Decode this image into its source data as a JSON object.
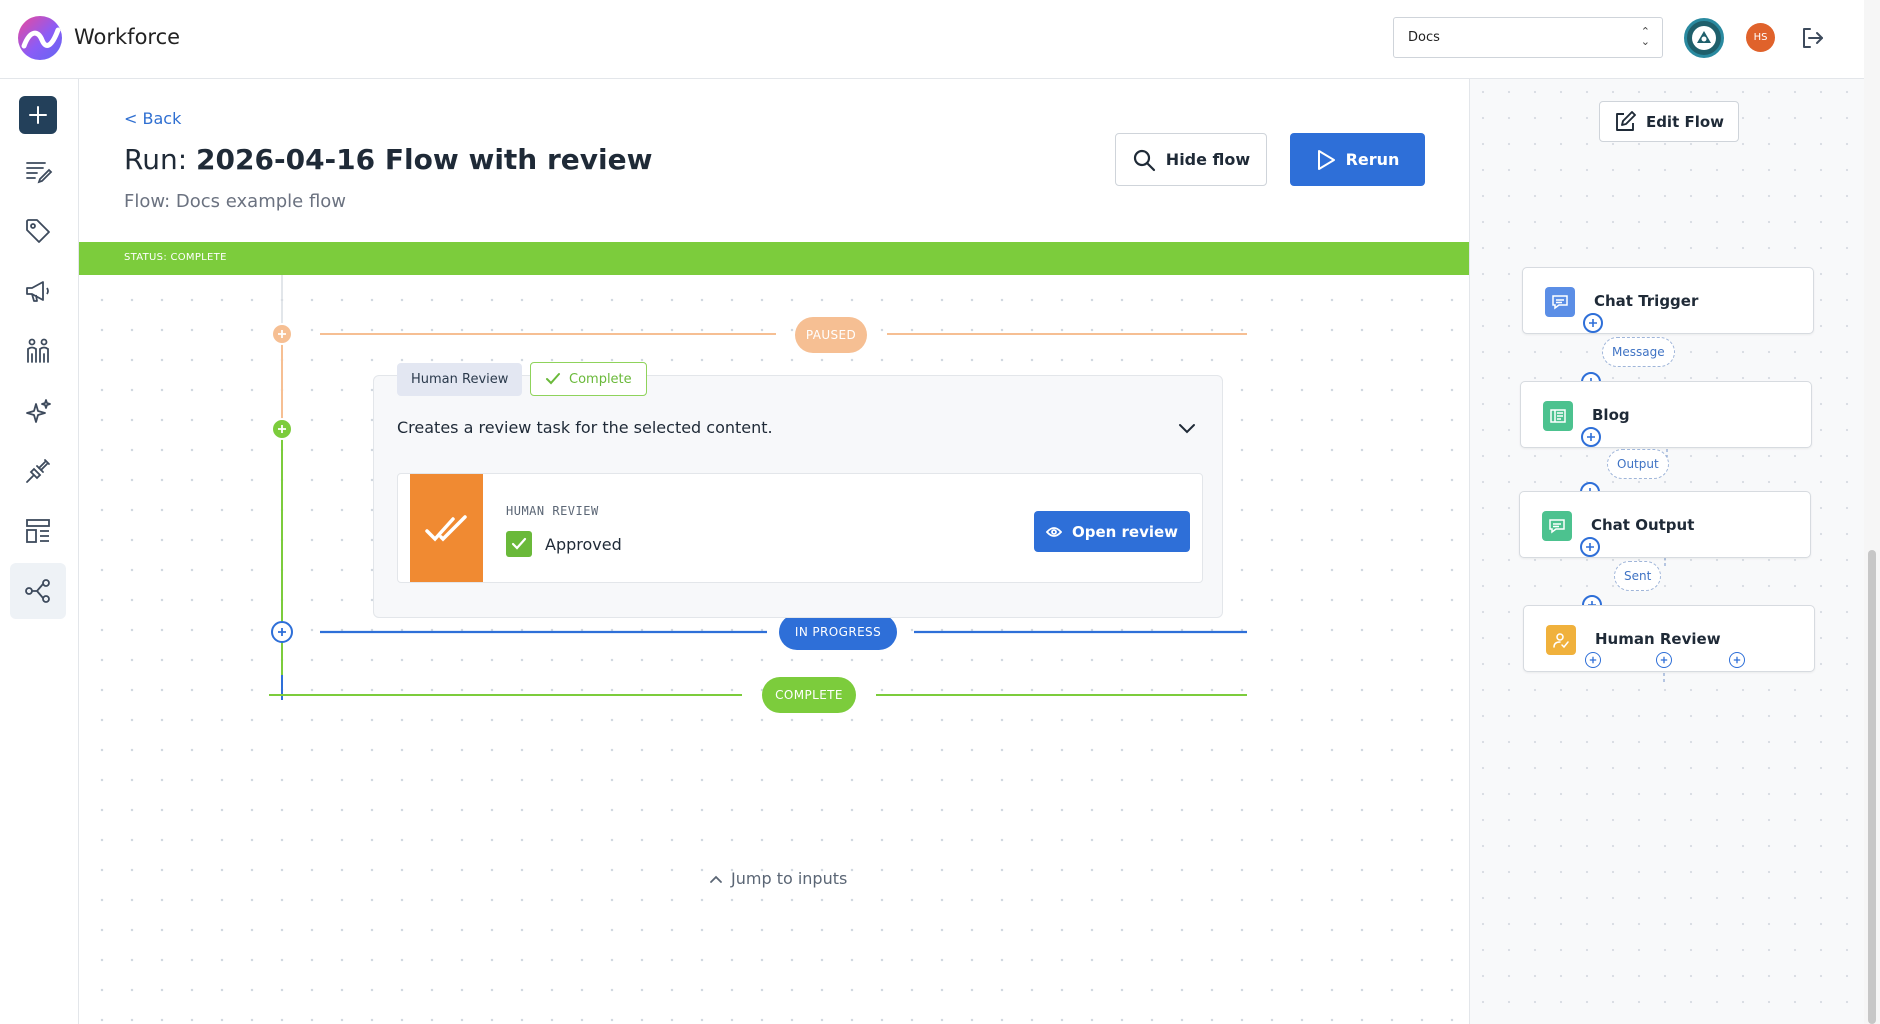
{
  "app": {
    "brand": "Workforce"
  },
  "header": {
    "workspace_select": {
      "value": "Docs"
    },
    "user_initials": "HS"
  },
  "sidebar": {
    "items": [
      {
        "name": "new",
        "icon": "plus-icon"
      },
      {
        "name": "content",
        "icon": "edit-list-icon"
      },
      {
        "name": "tags",
        "icon": "tag-icon"
      },
      {
        "name": "campaigns",
        "icon": "megaphone-icon"
      },
      {
        "name": "people",
        "icon": "people-icon"
      },
      {
        "name": "ai",
        "icon": "sparkle-icon"
      },
      {
        "name": "integrations",
        "icon": "plug-icon"
      },
      {
        "name": "templates",
        "icon": "layout-icon"
      },
      {
        "name": "flows",
        "icon": "flow-icon",
        "active": true
      }
    ]
  },
  "run": {
    "back_label": "< Back",
    "title_prefix": "Run:",
    "title": "2026-04-16 Flow with review",
    "flow_label": "Flow: Docs example flow",
    "hide_flow_label": "Hide flow",
    "rerun_label": "Rerun",
    "status_text": "STATUS: COMPLETE",
    "status_color": "#7ccc3c"
  },
  "timeline": {
    "paused_label": "PAUSED",
    "in_progress_label": "IN PROGRESS",
    "complete_label": "COMPLETE",
    "paused_color": "#f6bf93",
    "in_progress_color": "#2e6fd8",
    "complete_color": "#7ccc3c"
  },
  "step": {
    "name_tag": "Human Review",
    "status_tag": "Complete",
    "description": "Creates a review task for the selected content.",
    "result_type": "HUMAN REVIEW",
    "result_value": "Approved",
    "open_button_label": "Open review"
  },
  "jump_label": "Jump to inputs",
  "flow_panel": {
    "edit_label": "Edit Flow",
    "nodes": [
      {
        "label": "Chat Trigger",
        "icon": "chat-icon",
        "color": "#5b8ee6"
      },
      {
        "label": "Blog",
        "icon": "document-icon",
        "color": "#4cc28f"
      },
      {
        "label": "Chat Output",
        "icon": "chat-icon",
        "color": "#4cc28f"
      },
      {
        "label": "Human Review",
        "icon": "person-check-icon",
        "color": "#f0b13c"
      }
    ],
    "edges": [
      "Message",
      "Output",
      "Sent"
    ]
  }
}
